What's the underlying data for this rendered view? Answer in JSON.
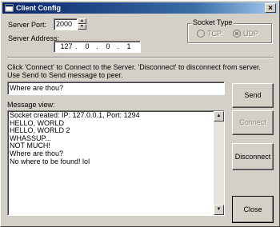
{
  "window": {
    "title": "Client Config",
    "close_glyph": "×"
  },
  "server_port": {
    "label": "Server Port:",
    "value": "2000"
  },
  "server_address": {
    "label": "Server Address:",
    "octets": [
      "127",
      "0",
      "0",
      "1"
    ]
  },
  "socket_type": {
    "legend": "Socket Type",
    "options": [
      {
        "label": "TCP",
        "checked": false
      },
      {
        "label": "UDP",
        "checked": true
      }
    ]
  },
  "instructions": {
    "line1": "Click 'Connect' to Connect to the Server.  'Disconnect' to disconnect from server.",
    "line2": "Use Send to Send message to peer."
  },
  "message_input": {
    "value": "Where are thou?"
  },
  "message_view": {
    "label": "Message view:",
    "lines": [
      "Socket created: IP: 127.0.0.1, Port: 1294",
      "HELLO, WORLD",
      "HELLO, WORLD 2",
      "WHASSUP...",
      "NOT MUCH!",
      "Where are thou?",
      "No where to be found! lol"
    ]
  },
  "buttons": {
    "send": "Send",
    "connect": "Connect",
    "disconnect": "Disconnect",
    "close": "Close"
  }
}
